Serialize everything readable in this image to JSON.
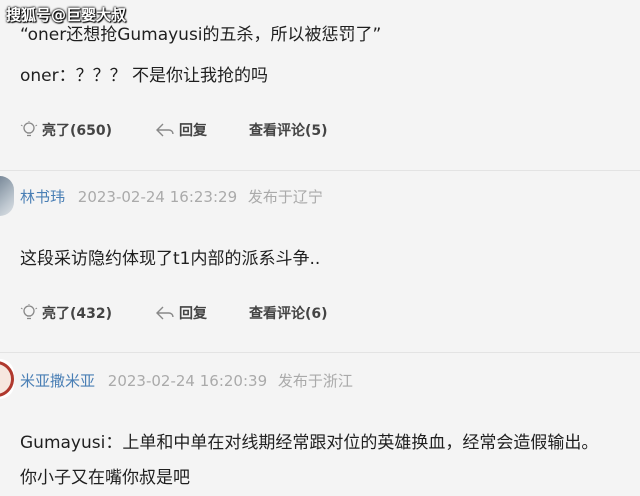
{
  "watermark": "搜狐号@巨婴大叔",
  "comment_top": {
    "quote_line": "“oner还想抢Gumayusi的五杀，所以被惩罚了”",
    "reply_line": "oner：？？？ 不是你让我抢的吗",
    "likes": "亮了(650)",
    "reply": "回复",
    "view_replies": "查看评论(5)"
  },
  "comment_1": {
    "user": "林书玮",
    "time": "2023-02-24 16:23:29",
    "location": "发布于辽宁",
    "text": "这段采访隐约体现了t1内部的派系斗争..",
    "likes": "亮了(432)",
    "reply": "回复",
    "view_replies": "查看评论(6)"
  },
  "comment_2": {
    "user": "米亚撒米亚",
    "time": "2023-02-24 16:20:39",
    "location": "发布于浙江",
    "text_line1": "Gumayusi：上单和中单在对线期经常跟对位的英雄换血，经常会造假输出。",
    "text_line2": "你小子又在嘴你叔是吧"
  },
  "icons": {
    "like": "lightbulb-icon",
    "reply": "reply-arrow-icon"
  },
  "colors": {
    "username": "#4a7fb5",
    "meta": "#aaaaaa",
    "background": "#f4f4f4"
  }
}
